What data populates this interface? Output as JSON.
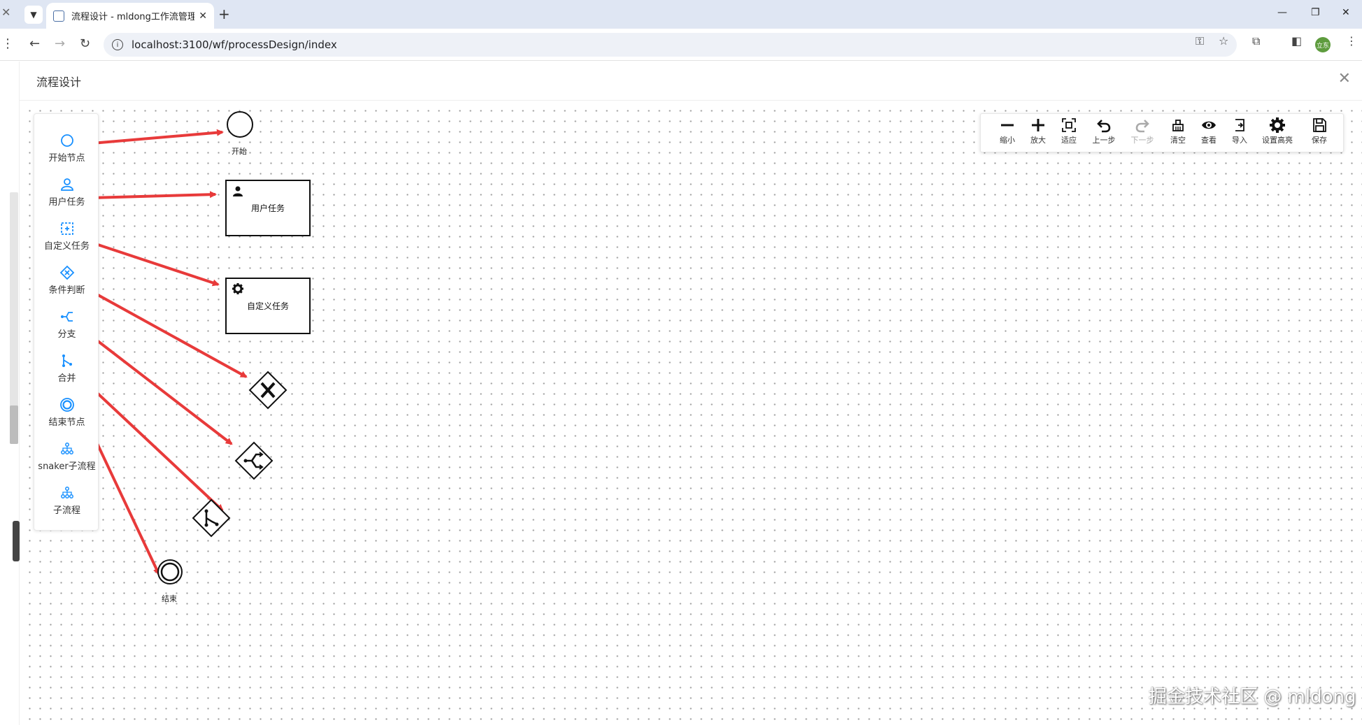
{
  "browser": {
    "tab_title": "流程设计 - mldong工作流管理",
    "url": "localhost:3100/wf/processDesign/index",
    "avatar_text": "立东"
  },
  "header": {
    "title": "流程设计"
  },
  "palette": {
    "items": [
      {
        "label": "开始节点",
        "icon": "circle-icon"
      },
      {
        "label": "用户任务",
        "icon": "user-icon"
      },
      {
        "label": "自定义任务",
        "icon": "custom-task-icon"
      },
      {
        "label": "条件判断",
        "icon": "decision-icon"
      },
      {
        "label": "分支",
        "icon": "fork-icon"
      },
      {
        "label": "合并",
        "icon": "join-icon"
      },
      {
        "label": "结束节点",
        "icon": "end-circle-icon"
      },
      {
        "label": "snaker子流程",
        "icon": "subprocess-icon"
      },
      {
        "label": "子流程",
        "icon": "subprocess-icon"
      }
    ],
    "accent_color": "#1890ff"
  },
  "toolbar": {
    "zoom_out": "缩小",
    "zoom_in": "放大",
    "fit": "适应",
    "undo": "上一步",
    "redo": "下一步",
    "clear": "清空",
    "view": "查看",
    "import": "导入",
    "highlight": "设置高亮",
    "save": "保存"
  },
  "diagram": {
    "start_label": "开始",
    "user_task_label": "用户任务",
    "custom_task_label": "自定义任务",
    "end_label": "结束",
    "arrow_color": "#e83a3a"
  },
  "watermark": "掘金技术社区 @ mldong"
}
